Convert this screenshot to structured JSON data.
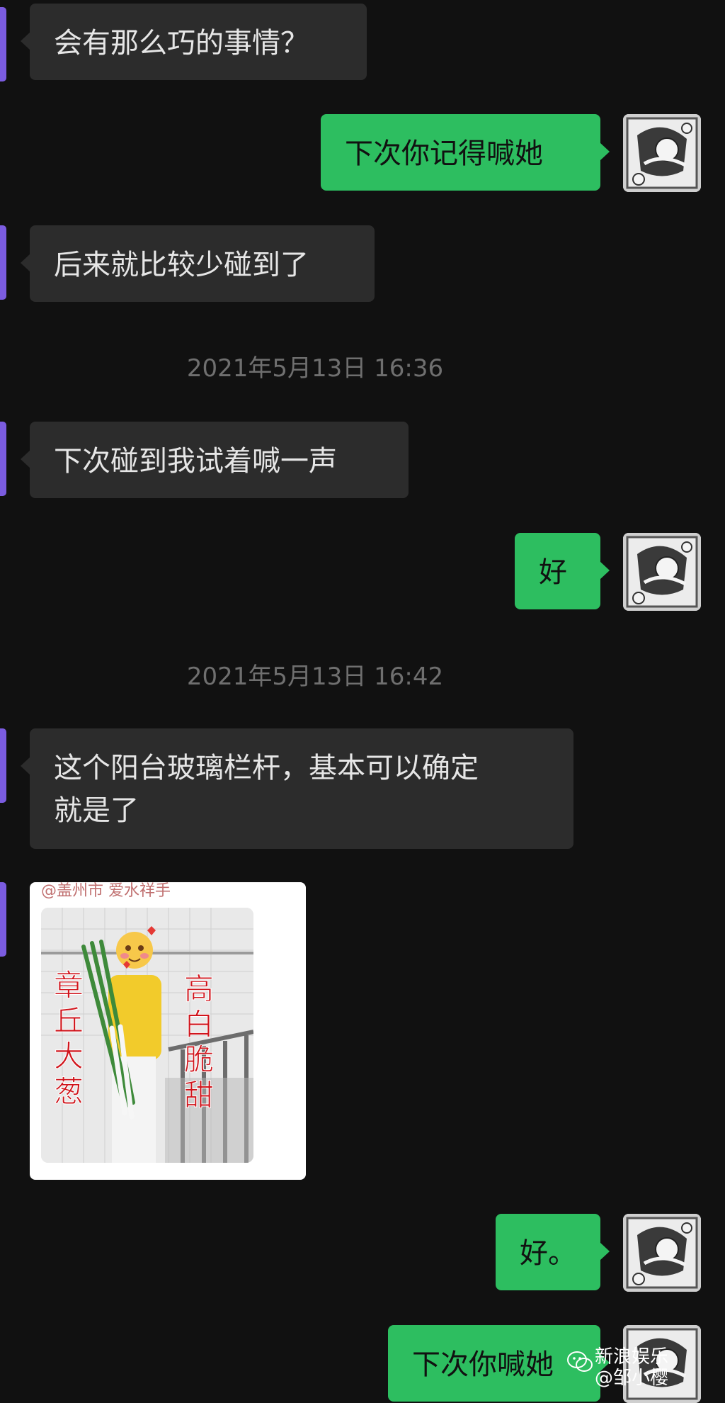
{
  "messages": {
    "m1": "会有那么巧的事情？",
    "m2": "下次你记得喊她",
    "m3": "后来就比较少碰到了",
    "ts1": "2021年5月13日 16:36",
    "m4": "下次碰到我试着喊一声",
    "m5": "好",
    "ts2": "2021年5月13日 16:42",
    "m6_line1": "这个阳台玻璃栏杆，基本可以确定",
    "m6_line2": "就是了",
    "image": {
      "header_text": "@盖州市 爱水祥手",
      "left_caption": [
        "章",
        "丘",
        "大",
        "葱"
      ],
      "right_caption": [
        "高",
        "白",
        "脆",
        "甜"
      ]
    },
    "m7": "好。",
    "m8": "下次你喊她"
  },
  "watermark": {
    "line1": "新浪娱乐",
    "line2": "@邹小樱"
  },
  "colors": {
    "background": "#111111",
    "incoming_bubble": "#2c2c2c",
    "outgoing_bubble": "#2dbe60",
    "timestamp": "#6f6f6f",
    "accent_tab": "#7b5ce0"
  },
  "icons": {
    "avatar": "anime-avatar-icon",
    "watermark_logo": "wechat-logo-icon"
  }
}
